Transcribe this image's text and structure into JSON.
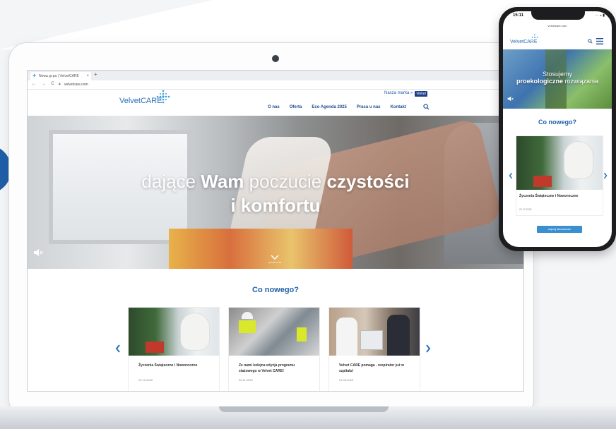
{
  "browser": {
    "tab_title": "Nowa gr.pa | VelvetCARE",
    "new_tab": "+",
    "nav_glyphs": "← → C",
    "url": "velvetcare.com"
  },
  "site": {
    "logo": "VelvetCARE",
    "brand_link": "Nasza marka »",
    "brand_badge": "Velvet",
    "nav": [
      "O nas",
      "Oferta",
      "Eco Agenda 2025",
      "Praca u nas",
      "Kontakt"
    ],
    "hero": {
      "line1_light_a": "dające ",
      "line1_bold_a": "Wam",
      "line1_light_b": " poczucie ",
      "line1_bold_b": "czystości",
      "line2": "i komfortu",
      "scroll_label": "przewiń w dół"
    },
    "news_title": "Co nowego?",
    "cards": [
      {
        "title": "Życzenia Świąteczne i Noworoczne",
        "date": "22.12.2020"
      },
      {
        "title": "Ze nami kolejna edycja programu stażowego w Velvet CARE!",
        "date": "05.11.2020"
      },
      {
        "title": "Velvet CARE pomaga - respirator już w szpitalu!",
        "date": "01.06.2020"
      }
    ]
  },
  "phone": {
    "time": "15:11",
    "status": "··· ◒ ▮",
    "url": "velvetcare.com",
    "logo": "VelvetCARE",
    "hero_line1": "Stosujemy",
    "hero_line2_bold": "proekologiczne",
    "hero_line2_light": " rozwiązania",
    "news_title": "Co nowego?",
    "card_title": "Życzenia Świąteczne i Noworoczne",
    "card_date": "22.12.2020",
    "more_button": "więcej aktualności"
  },
  "colors": {
    "brand_blue": "#1f5fa8",
    "logo_cyan": "#3aa0d8",
    "button_blue": "#3a8fd0"
  }
}
